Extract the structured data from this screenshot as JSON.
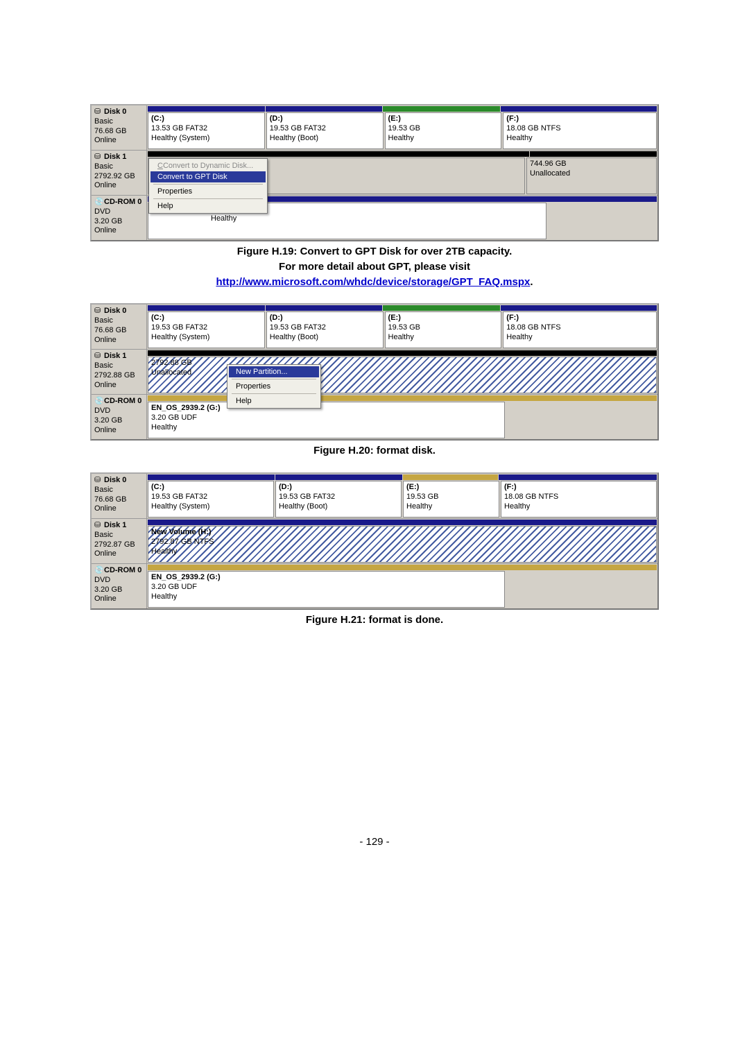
{
  "disk0_name": "Disk 0",
  "disk0_type": "Basic",
  "disk0_size": "76.68 GB",
  "disk0_status": "Online",
  "disk1_name": "Disk 1",
  "disk1_type": "Basic",
  "disk1_status": "Online",
  "cdrom_name": "CD-ROM 0",
  "cdrom_type": "DVD",
  "cdrom_size": "3.20 GB",
  "cdrom_status": "Online",
  "volC_label": "(C:)",
  "volC_line2": "13.53 GB FAT32",
  "volC_line2b": "19.53 GB FAT32",
  "volC_line3": "Healthy (System)",
  "volD_label": "(D:)",
  "volD_line2": "19.53 GB FAT32",
  "volD_line3": "Healthy (Boot)",
  "volE_label": "(E:)",
  "volE_line2": "19.53 GB",
  "volE_line3": "Healthy",
  "volF_label": "(F:)",
  "volF_line2": "18.08 GB NTFS",
  "volF_line3": "Healthy",
  "fig19": {
    "disk1_size": "2792.92 GB",
    "unalloc_size": "744.96 GB",
    "unalloc_status": "Unallocated",
    "cdrom_healthy": "Healthy",
    "menu": {
      "m1": "Convert to Dynamic Disk...",
      "m2": "Convert to GPT Disk",
      "m3": "Properties",
      "m4": "Help"
    }
  },
  "fig20": {
    "disk1_size": "2792.88 GB",
    "unalloc_label": "2792.88 GB",
    "unalloc_status": "Unallocated",
    "cd_vol_label": "EN_OS_2939.2 (G:)",
    "cd_vol_line2": "3.20 GB UDF",
    "cd_vol_line3": "Healthy",
    "menu": {
      "m1": "New Partition...",
      "m2": "Properties",
      "m3": "Help"
    }
  },
  "fig21": {
    "disk1_size": "2792.87 GB",
    "volH_label": "New Volume (H:)",
    "volH_line2": "2792.87 GB NTFS",
    "volH_line3": "Healthy",
    "cd_vol_label": "EN_OS_2939.2 (G:)",
    "cd_vol_line2": "3.20 GB UDF",
    "cd_vol_line3": "Healthy"
  },
  "captions": {
    "c19a": "Figure H.19: Convert to GPT Disk for over 2TB capacity.",
    "c19b": "For more detail about GPT, please visit",
    "c19link": "http://www.microsoft.com/whdc/device/storage/GPT_FAQ.mspx",
    "c19dot": ".",
    "c20": "Figure H.20: format disk.",
    "c21": "Figure H.21: format is done."
  },
  "pagenum": "- 129 -",
  "ui": {
    "disk_icon": "⛁",
    "cd_icon": "💿"
  }
}
